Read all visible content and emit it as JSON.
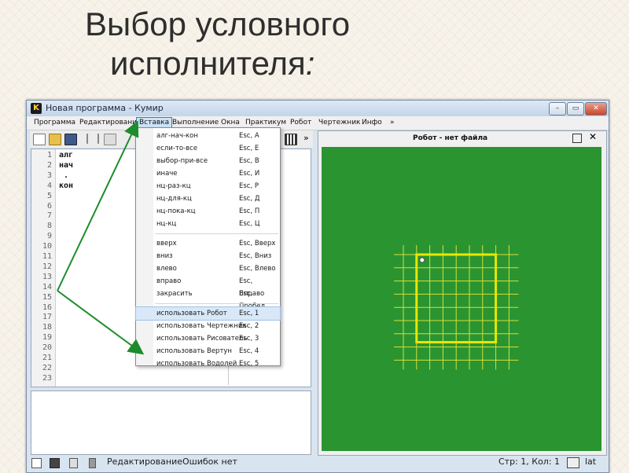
{
  "slide": {
    "title_line1": "Выбор условного",
    "title_line2": "исполнителя",
    "title_colon": ":"
  },
  "window": {
    "title": "Новая программа - Кумир",
    "app_icon_letter": "K",
    "controls": {
      "minimize": "–",
      "maximize": "▭",
      "close": "✕"
    },
    "toolbar_more": "»"
  },
  "menubar": [
    "Программа",
    "Редактирование",
    "Вставка",
    "Выполнение",
    "Окна",
    "Практикум",
    "Робот",
    "Чертежник",
    "Инфо",
    "»"
  ],
  "editor": {
    "line_numbers": [
      "1",
      "2",
      "3",
      "4",
      "5",
      "6",
      "7",
      "8",
      "9",
      "10",
      "11",
      "12",
      "13",
      "14",
      "15",
      "16",
      "17",
      "18",
      "19",
      "20",
      "21",
      "22",
      "23"
    ],
    "code_lines": [
      "алг",
      "нач",
      " .",
      "кон"
    ]
  },
  "insert_menu": {
    "group1": [
      {
        "label": "алг-нач-кон",
        "shortcut": "Esc, A"
      },
      {
        "label": "если-то-все",
        "shortcut": "Esc, E"
      },
      {
        "label": "выбор-при-все",
        "shortcut": "Esc, B"
      },
      {
        "label": "иначе",
        "shortcut": "Esc, И"
      },
      {
        "label": "нц-раз-кц",
        "shortcut": "Esc, P"
      },
      {
        "label": "нц-для-кц",
        "shortcut": "Esc, Д"
      },
      {
        "label": "нц-пока-кц",
        "shortcut": "Esc, П"
      },
      {
        "label": "нц-кц",
        "shortcut": "Esc, Ц"
      }
    ],
    "group2": [
      {
        "label": "вверх",
        "shortcut": "Esc, Вверх"
      },
      {
        "label": "вниз",
        "shortcut": "Esc, Вниз"
      },
      {
        "label": "влево",
        "shortcut": "Esc, Влево"
      },
      {
        "label": "вправо",
        "shortcut": "Esc, Вправо"
      },
      {
        "label": "закрасить",
        "shortcut": "Esc, Пробел"
      }
    ],
    "group3": [
      {
        "label": "использовать Робот",
        "shortcut": "Esc, 1"
      },
      {
        "label": "использовать Чертежник",
        "shortcut": "Esc, 2"
      },
      {
        "label": "использовать Рисователь",
        "shortcut": "Esc, 3"
      },
      {
        "label": "использовать Вертун",
        "shortcut": "Esc, 4"
      },
      {
        "label": "использовать Водолей",
        "shortcut": "Esc, 5"
      }
    ]
  },
  "robot_window": {
    "title": "Робот - нет файла",
    "field_color": "#2a9430",
    "grid_color": "#d6e03a",
    "wall_color": "#e8e800"
  },
  "statusbar": {
    "mode": "Редактирование",
    "errors": "Ошибок нет",
    "position": "Стр: 1, Кол: 1",
    "layout": "lat"
  },
  "colors": {
    "arrow": "#1d8c2a",
    "menu_highlight": "#cde4f7"
  }
}
